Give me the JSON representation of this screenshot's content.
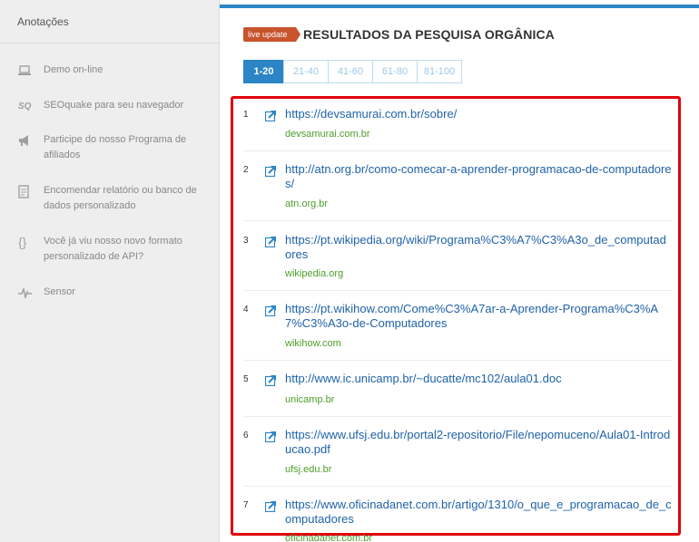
{
  "sidebar": {
    "header": "Anotações",
    "items": [
      {
        "label": "Demo on-line",
        "icon": "laptop-icon"
      },
      {
        "label": "SEOquake para seu navegador",
        "icon": "seoquake-icon",
        "glyph": "SQ"
      },
      {
        "label": "Participe do nosso Programa de afiliados",
        "icon": "megaphone-icon"
      },
      {
        "label": "Encomendar relatório ou banco de dados personalizado",
        "icon": "document-icon"
      },
      {
        "label": "Você já viu nosso novo formato personalizado de API?",
        "icon": "braces-icon",
        "glyph": "{}"
      },
      {
        "label": "Sensor",
        "icon": "pulse-icon"
      }
    ]
  },
  "main": {
    "badge": "live update",
    "title": "RESULTADOS DA PESQUISA ORGÂNICA",
    "pages": [
      "1-20",
      "21-40",
      "41-60",
      "61-80",
      "81-100"
    ],
    "active_page": "1-20",
    "results": [
      {
        "num": "1",
        "url": "https://devsamurai.com.br/sobre/",
        "domain": "devsamurai.com.br"
      },
      {
        "num": "2",
        "url": "http://atn.org.br/como-comecar-a-aprender-programacao-de-computadores/",
        "domain": "atn.org.br"
      },
      {
        "num": "3",
        "url": "https://pt.wikipedia.org/wiki/Programa%C3%A7%C3%A3o_de_computadores",
        "domain": "wikipedia.org"
      },
      {
        "num": "4",
        "url": "https://pt.wikihow.com/Come%C3%A7ar-a-Aprender-Programa%C3%A7%C3%A3o-de-Computadores",
        "domain": "wikihow.com"
      },
      {
        "num": "5",
        "url": "http://www.ic.unicamp.br/~ducatte/mc102/aula01.doc",
        "domain": "unicamp.br"
      },
      {
        "num": "6",
        "url": "https://www.ufsj.edu.br/portal2-repositorio/File/nepomuceno/Aula01-Introducao.pdf",
        "domain": "ufsj.edu.br"
      },
      {
        "num": "7",
        "url": "https://www.oficinadanet.com.br/artigo/1310/o_que_e_programacao_de_computadores",
        "domain": "oficinadanet.com.br"
      }
    ]
  },
  "colors": {
    "accent": "#2b85c7",
    "badge": "#c8542e",
    "highlight_border": "#e0000b",
    "link": "#1f62a8",
    "domain": "#4c9e2a"
  }
}
